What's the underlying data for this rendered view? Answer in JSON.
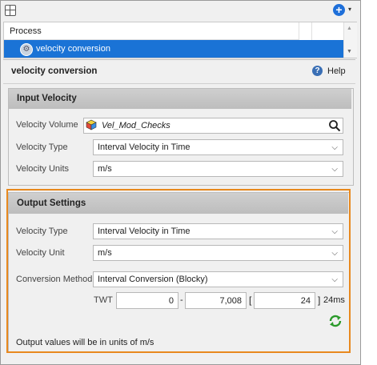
{
  "toolbar": {
    "panel_icon": "panel-icon",
    "add_icon": "add-circle-icon",
    "add_symbol": "+",
    "caret": "▾"
  },
  "process_table": {
    "header": "Process",
    "selected_item": {
      "label": "velocity conversion",
      "icon": "gear-icon"
    }
  },
  "panel": {
    "title": "velocity conversion",
    "help_label": "Help",
    "help_symbol": "?"
  },
  "input_velocity": {
    "header": "Input Velocity",
    "volume_label": "Velocity Volume",
    "volume_value": "Vel_Mod_Checks",
    "type_label": "Velocity Type",
    "type_value": "Interval Velocity in Time",
    "units_label": "Velocity Units",
    "units_value": "m/s"
  },
  "output_settings": {
    "header": "Output Settings",
    "type_label": "Velocity Type",
    "type_value": "Interval Velocity in Time",
    "unit_label": "Velocity Unit",
    "unit_value": "m/s",
    "method_label": "Conversion Method",
    "method_value": "Interval Conversion (Blocky)",
    "twt_label": "TWT",
    "twt_start": "0",
    "dash": "-",
    "twt_end": "7,008",
    "bracket_open": "[",
    "twt_step": "24",
    "bracket_close": "]",
    "twt_unit": "24ms",
    "status_text": "Output values will be in units of m/s"
  },
  "colors": {
    "selection": "#1a73d6",
    "highlight": "#e8891e",
    "refresh": "#2a9a2a"
  }
}
